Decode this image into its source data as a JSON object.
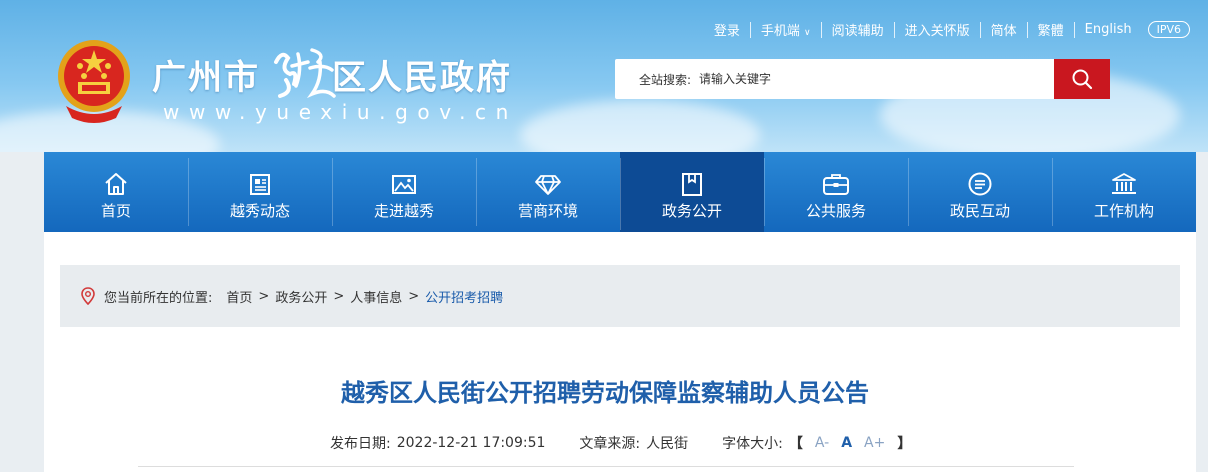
{
  "header": {
    "site_name_left": "广州市",
    "site_name_calligraphy": "越秀",
    "site_name_right": "区人民政府",
    "url": "www.yuexiu.gov.cn",
    "top_links": [
      "登录",
      "手机端",
      "阅读辅助",
      "进入关怀版",
      "简体",
      "繁體",
      "English"
    ],
    "ipv6": "IPV6",
    "search": {
      "label": "全站搜索:",
      "placeholder": "请输入关键字"
    }
  },
  "nav": {
    "items": [
      {
        "label": "首页",
        "icon": "home-icon"
      },
      {
        "label": "越秀动态",
        "icon": "newspaper-icon"
      },
      {
        "label": "走进越秀",
        "icon": "picture-icon"
      },
      {
        "label": "营商环境",
        "icon": "diamond-icon"
      },
      {
        "label": "政务公开",
        "icon": "document-icon"
      },
      {
        "label": "公共服务",
        "icon": "briefcase-icon"
      },
      {
        "label": "政民互动",
        "icon": "chat-icon"
      },
      {
        "label": "工作机构",
        "icon": "building-icon"
      }
    ],
    "active": "政务公开"
  },
  "breadcrumb": {
    "lead": "您当前所在的位置:",
    "items": [
      "首页",
      "政务公开",
      "人事信息",
      "公开招考招聘"
    ]
  },
  "article": {
    "title": "越秀区人民街公开招聘劳动保障监察辅助人员公告",
    "date_label": "发布日期:",
    "date": "2022-12-21 17:09:51",
    "source_label": "文章来源:",
    "source": "人民街",
    "font_label": "字体大小:",
    "font_small": "A-",
    "font_mid": "A",
    "font_large": "A+",
    "bracket_open": "【",
    "bracket_close": "】"
  },
  "colors": {
    "nav_blue": "#1468bd",
    "nav_active": "#0d4b95",
    "search_red": "#c9171f",
    "title_blue": "#1f5faa"
  }
}
